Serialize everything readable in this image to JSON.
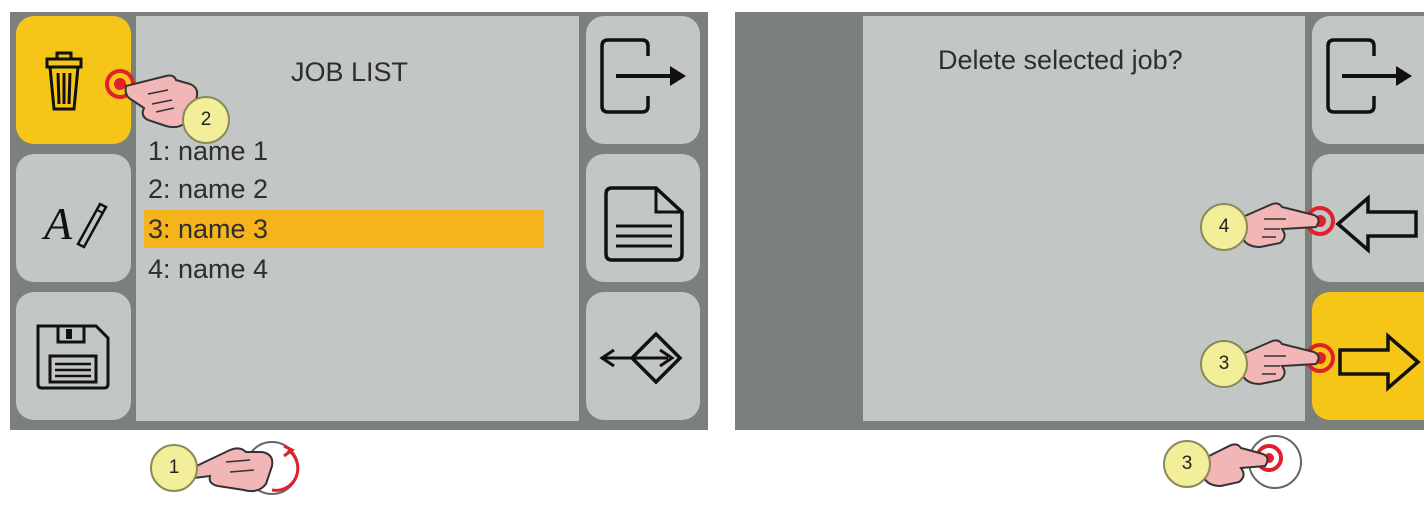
{
  "left_screen": {
    "title": "JOB LIST",
    "jobs": [
      "1: name 1",
      "2: name 2",
      "3: name 3",
      "4: name 4"
    ],
    "selected_index": 2,
    "left_buttons": [
      {
        "icon": "trash-icon",
        "active": true
      },
      {
        "icon": "rename-icon",
        "active": false
      },
      {
        "icon": "save-icon",
        "active": false
      }
    ],
    "right_buttons": [
      {
        "icon": "exit-icon"
      },
      {
        "icon": "document-icon"
      },
      {
        "icon": "import-export-icon"
      }
    ]
  },
  "right_screen": {
    "prompt": "Delete selected job?",
    "right_buttons": [
      {
        "icon": "exit-icon",
        "active": false
      },
      {
        "icon": "back-arrow-icon",
        "active": false
      },
      {
        "icon": "forward-arrow-icon",
        "active": true
      }
    ]
  },
  "annotations": {
    "badge_1": "1",
    "badge_2": "2",
    "badge_3a": "3",
    "badge_3b": "3",
    "badge_4": "4"
  },
  "colors": {
    "screen_border": "#7a807c",
    "panel": "#c2c6c4",
    "active_button": "#f5c518",
    "selected_row": "#f5b41c",
    "badge": "#f3ee9a",
    "hand": "#f2b6b6",
    "touch": "#e0202a"
  }
}
